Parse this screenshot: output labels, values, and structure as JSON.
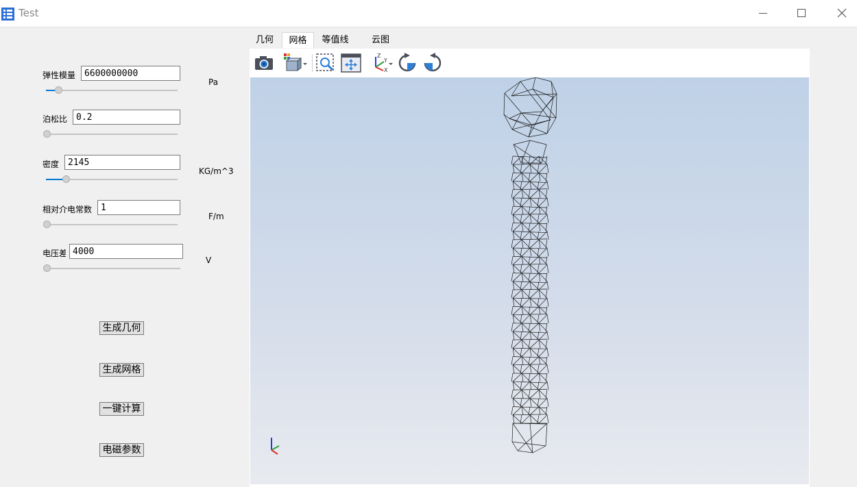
{
  "window": {
    "title": "Test"
  },
  "params": {
    "fields": [
      {
        "label": "弹性模量",
        "value": "6600000000",
        "unit": "Pa",
        "slider_fraction": 0.07
      },
      {
        "label": "泊松比",
        "value": "0.2",
        "unit": "",
        "slider_fraction": 0.0
      },
      {
        "label": "密度",
        "value": "2145",
        "unit": "KG/m^3",
        "slider_fraction": 0.13
      },
      {
        "label": "相对介电常数",
        "value": "1",
        "unit": "F/m",
        "slider_fraction": 0.0
      },
      {
        "label": "电压差",
        "value": "4000",
        "unit": "V",
        "slider_fraction": 0.0
      }
    ]
  },
  "actions": {
    "generate_geometry": "生成几何",
    "generate_mesh": "生成网格",
    "compute": "一键计算",
    "em_params": "电磁参数"
  },
  "tabs": [
    {
      "label": "几何",
      "active": false
    },
    {
      "label": "网格",
      "active": true
    },
    {
      "label": "等值线",
      "active": false
    },
    {
      "label": "云图",
      "active": false
    }
  ],
  "toolbar": {
    "icons": [
      "camera-icon",
      "view-cube-icon",
      "zoom-box-icon",
      "fit-all-icon",
      "axes-orientation-icon",
      "rotate-clockwise-icon",
      "rotate-counterclockwise-icon"
    ],
    "axis_labels": {
      "z": "Z",
      "y": "Y",
      "x": "X"
    }
  },
  "colors": {
    "background_top": "#bfd1e7",
    "background_bottom": "#e8eaef",
    "mesh_line": "#1a1a1a",
    "slider_accent": "#0078d7",
    "axis_x": "#e0302a",
    "axis_y": "#2ea043",
    "axis_z": "#1f3fd8"
  }
}
